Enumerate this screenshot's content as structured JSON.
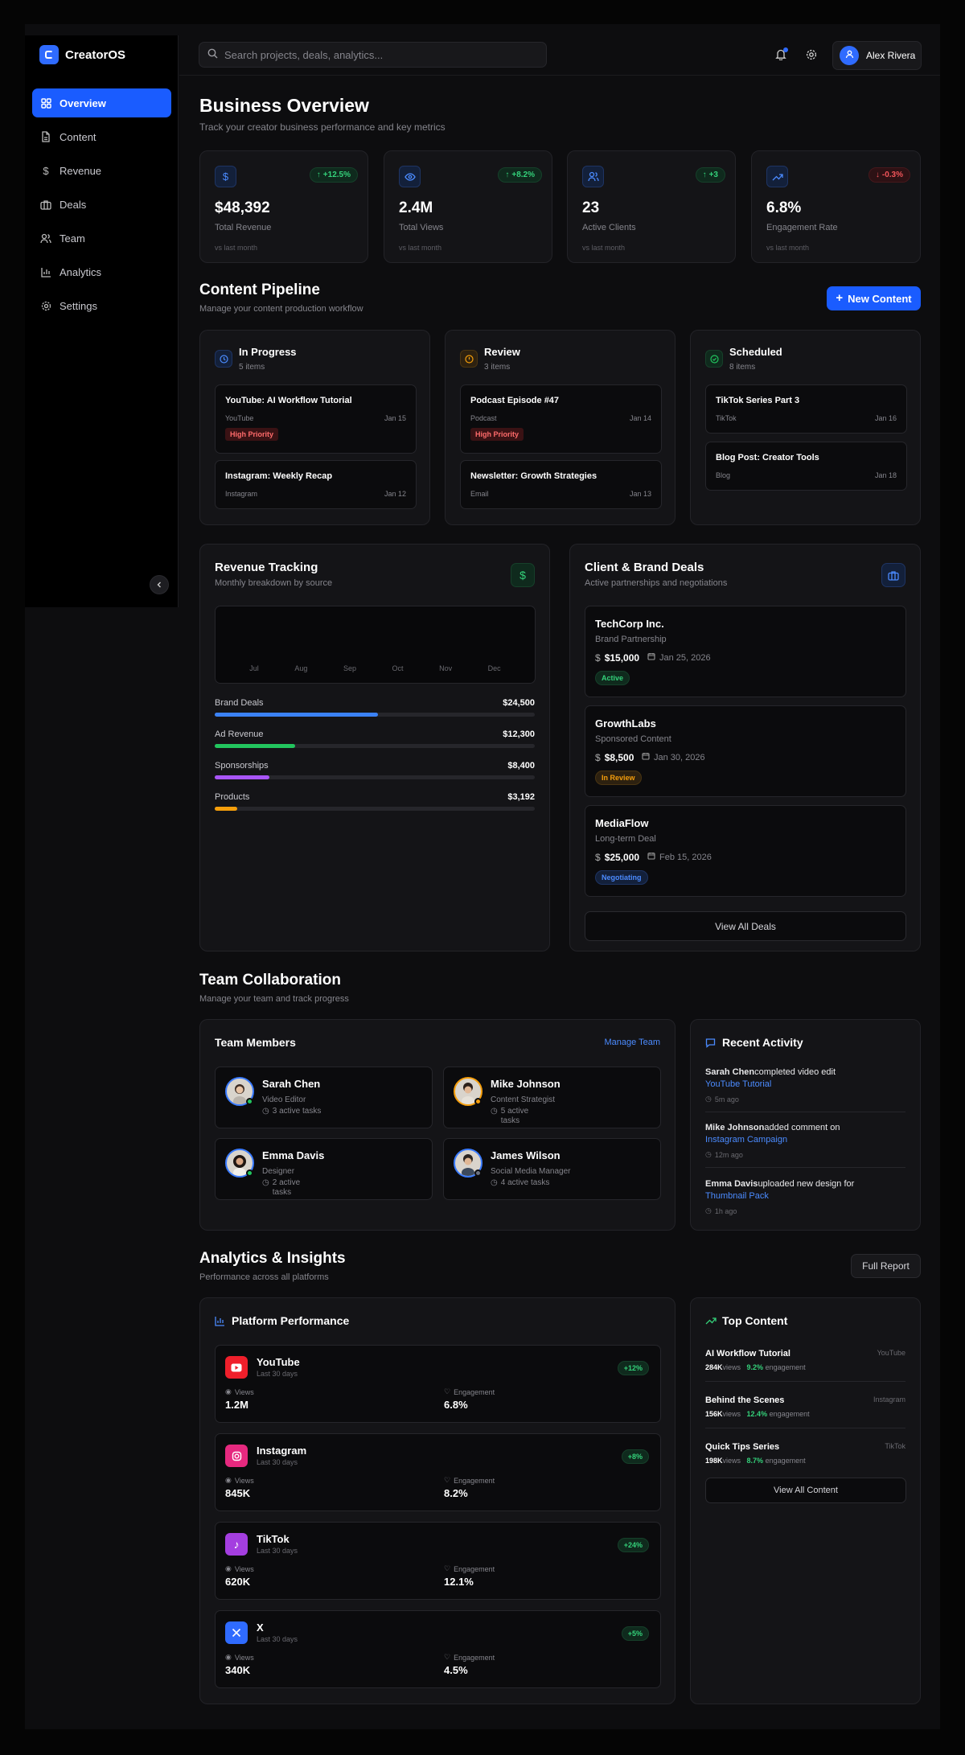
{
  "app": {
    "name": "CreatorOS"
  },
  "nav": [
    {
      "label": "Overview",
      "icon": "grid-icon"
    },
    {
      "label": "Content",
      "icon": "file-icon"
    },
    {
      "label": "Revenue",
      "icon": "dollar-icon"
    },
    {
      "label": "Deals",
      "icon": "briefcase-icon"
    },
    {
      "label": "Team",
      "icon": "users-icon"
    },
    {
      "label": "Analytics",
      "icon": "bar-chart-icon"
    },
    {
      "label": "Settings",
      "icon": "gear-icon"
    }
  ],
  "topbar": {
    "search_placeholder": "Search projects, deals, analytics...",
    "user_name": "Alex Rivera"
  },
  "overview": {
    "title": "Business Overview",
    "subtitle": "Track your creator business performance and key metrics",
    "stats": [
      {
        "value": "$48,392",
        "label": "Total Revenue",
        "change": "+12.5%",
        "foot": "vs last month",
        "icon": "dollar-icon",
        "color": "#3b82f6"
      },
      {
        "value": "2.4M",
        "label": "Total Views",
        "change": "+8.2%",
        "foot": "vs last month",
        "icon": "eye-icon",
        "color": "#3b82f6"
      },
      {
        "value": "23",
        "label": "Active Clients",
        "change": "+3",
        "foot": "vs last month",
        "icon": "users-icon",
        "color": "#3b82f6"
      },
      {
        "value": "6.8%",
        "label": "Engagement Rate",
        "change": "-0.3%",
        "foot": "vs last month",
        "icon": "trending-up-icon",
        "color": "#3b82f6"
      }
    ]
  },
  "pipeline": {
    "title": "Content Pipeline",
    "subtitle": "Manage your content production workflow",
    "new_button": "New Content",
    "columns": [
      {
        "title": "In Progress",
        "count": "5 items",
        "color": "#3b82f6",
        "tasks": [
          {
            "title": "YouTube: AI Workflow Tutorial",
            "platform": "YouTube",
            "date": "Jan 15",
            "priority": "High Priority"
          },
          {
            "title": "Instagram: Weekly Recap",
            "platform": "Instagram",
            "date": "Jan 12",
            "priority": ""
          }
        ]
      },
      {
        "title": "Review",
        "count": "3 items",
        "color": "#f59e0b",
        "tasks": [
          {
            "title": "Podcast Episode #47",
            "platform": "Podcast",
            "date": "Jan 14",
            "priority": "High Priority"
          },
          {
            "title": "Newsletter: Growth Strategies",
            "platform": "Email",
            "date": "Jan 13",
            "priority": ""
          }
        ]
      },
      {
        "title": "Scheduled",
        "count": "8 items",
        "color": "#22c55e",
        "tasks": [
          {
            "title": "TikTok Series Part 3",
            "platform": "TikTok",
            "date": "Jan 16",
            "priority": ""
          },
          {
            "title": "Blog Post: Creator Tools",
            "platform": "Blog",
            "date": "Jan 18",
            "priority": ""
          }
        ]
      }
    ]
  },
  "revenue": {
    "title": "Revenue Tracking",
    "subtitle": "Monthly breakdown by source",
    "months": [
      "Jul",
      "Aug",
      "Sep",
      "Oct",
      "Nov",
      "Dec"
    ],
    "sources": [
      {
        "label": "Brand Deals",
        "value": "$24,500",
        "share": 0.51,
        "color": "#3b82f6"
      },
      {
        "label": "Ad Revenue",
        "value": "$12,300",
        "share": 0.25,
        "color": "#22c55e"
      },
      {
        "label": "Sponsorships",
        "value": "$8,400",
        "share": 0.17,
        "color": "#a855f7"
      },
      {
        "label": "Products",
        "value": "$3,192",
        "share": 0.07,
        "color": "#f59e0b"
      }
    ]
  },
  "deals": {
    "title": "Client & Brand Deals",
    "subtitle": "Active partnerships and negotiations",
    "items": [
      {
        "client": "TechCorp Inc.",
        "type": "Brand Partnership",
        "amount": "$15,000",
        "date": "Jan 25, 2026",
        "status": "Active",
        "status_color": "#22c55e"
      },
      {
        "client": "GrowthLabs",
        "type": "Sponsored Content",
        "amount": "$8,500",
        "date": "Jan 30, 2026",
        "status": "In Review",
        "status_color": "#f59e0b"
      },
      {
        "client": "MediaFlow",
        "type": "Long-term Deal",
        "amount": "$25,000",
        "date": "Feb 15, 2026",
        "status": "Negotiating",
        "status_color": "#3b82f6"
      }
    ],
    "view_all": "View All Deals"
  },
  "team": {
    "title": "Team Collaboration",
    "subtitle": "Manage your team and track progress",
    "members_title": "Team Members",
    "manage_link": "Manage Team",
    "members": [
      {
        "name": "Sarah Chen",
        "role": "Video Editor",
        "tasks": "3 active tasks",
        "status_color": "#22c55e"
      },
      {
        "name": "Mike Johnson",
        "role": "Content Strategist",
        "tasks": "5 active tasks",
        "status_color": "#f59e0b"
      },
      {
        "name": "Emma Davis",
        "role": "Designer",
        "tasks": "2 active tasks",
        "status_color": "#22c55e"
      },
      {
        "name": "James Wilson",
        "role": "Social Media Manager",
        "tasks": "4 active tasks",
        "status_color": "#6b7280"
      }
    ],
    "activity_title": "Recent Activity",
    "activity": [
      {
        "user": "Sarah Chen",
        "action": "completed video edit",
        "target": "YouTube Tutorial",
        "time": "5m ago"
      },
      {
        "user": "Mike Johnson",
        "action": "added comment on",
        "target": "Instagram Campaign",
        "time": "12m ago"
      },
      {
        "user": "Emma Davis",
        "action": "uploaded new design for",
        "target": "Thumbnail Pack",
        "time": "1h ago"
      }
    ]
  },
  "analytics": {
    "title": "Analytics & Insights",
    "subtitle": "Performance across all platforms",
    "report_button": "Full Report",
    "platform_title": "Platform Performance",
    "views_label": "Views",
    "engagement_label": "Engagement",
    "platforms": [
      {
        "name": "YouTube",
        "period": "Last 30 days",
        "growth": "+12%",
        "views": "1.2M",
        "engagement": "6.8%",
        "color": "#ef1f2b",
        "icon": "youtube-icon"
      },
      {
        "name": "Instagram",
        "period": "Last 30 days",
        "growth": "+8%",
        "views": "845K",
        "engagement": "8.2%",
        "color": "#e6297f",
        "icon": "instagram-icon"
      },
      {
        "name": "TikTok",
        "period": "Last 30 days",
        "growth": "+24%",
        "views": "620K",
        "engagement": "12.1%",
        "color": "#a43ee0",
        "icon": "tiktok-icon"
      },
      {
        "name": "X",
        "period": "Last 30 days",
        "growth": "+5%",
        "views": "340K",
        "engagement": "4.5%",
        "color": "#2f6bff",
        "icon": "x-icon"
      }
    ],
    "top_title": "Top Content",
    "views_word": "views",
    "engagement_word": "engagement",
    "top": [
      {
        "title": "AI Workflow Tutorial",
        "platform": "YouTube",
        "views": "284K",
        "engagement": "9.2%"
      },
      {
        "title": "Behind the Scenes",
        "platform": "Instagram",
        "views": "156K",
        "engagement": "12.4%"
      },
      {
        "title": "Quick Tips Series",
        "platform": "TikTok",
        "views": "198K",
        "engagement": "8.7%"
      }
    ],
    "view_all": "View All Content"
  }
}
